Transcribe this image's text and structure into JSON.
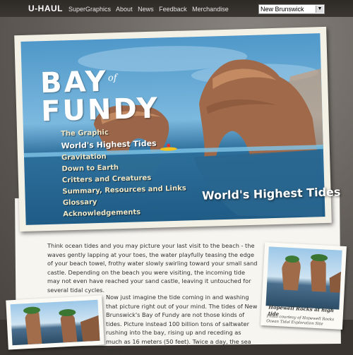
{
  "header": {
    "logo": "U-HAUL",
    "nav": [
      "SuperGraphics",
      "About",
      "News",
      "Feedback",
      "Merchandise"
    ],
    "region_selected": "New Brunswick"
  },
  "card": {
    "title_line1": "BAY",
    "title_of": "of",
    "title_line2": "FUNDY",
    "menu": [
      {
        "label": "The Graphic",
        "active": false
      },
      {
        "label": "World's Highest Tides",
        "active": true
      },
      {
        "label": "Gravitation",
        "active": false
      },
      {
        "label": "Down to Earth",
        "active": false
      },
      {
        "label": "Critters and Creatures",
        "active": false
      },
      {
        "label": "Summary, Resources and Links",
        "active": false
      },
      {
        "label": "Glossary",
        "active": false
      },
      {
        "label": "Acknowledgements",
        "active": false
      }
    ],
    "tagline": "World's Highest Tides"
  },
  "body": {
    "p1": "Think ocean tides and you may picture your last visit to the beach - the waves gently lapping at your toes, the water playfully teasing the edge of your beach towel, frothy water slowly swirling toward your small sand castle. Depending on the beach you were visiting, the incoming tide may not even have reached your sand castle, leaving it untouched for several tidal cycles.",
    "p2": "Now just imagine the tide coming in and washing that picture right out of your mind. The tides of New Brunswick's Bay of Fundy are not those kinds of tides. Picture instead 100 billion tons of saltwater rushing into the bay, rising up and receding as much as 16 meters (50 feet). Twice a day, the sea levels"
  },
  "photo_right": {
    "caption": "Hopewell Rocks at high tide",
    "credit": "Photo courtesy of Hopewell Rocks Ocean Tidal Exploration Site"
  }
}
